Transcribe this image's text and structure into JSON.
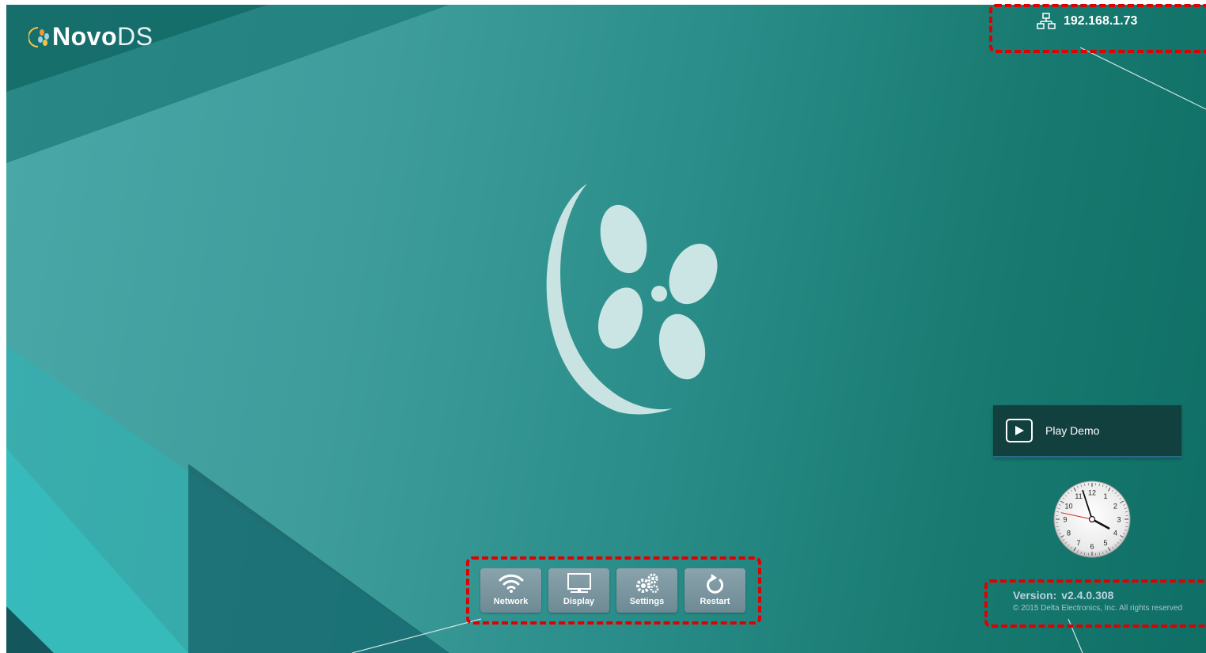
{
  "app": {
    "logo_bold": "Novo",
    "logo_light": "DS"
  },
  "network_status": {
    "icon": "ethernet-icon",
    "ip": "192.168.1.73"
  },
  "toolbar": {
    "buttons": [
      {
        "label": "Network",
        "icon": "wifi-icon"
      },
      {
        "label": "Display",
        "icon": "monitor-icon"
      },
      {
        "label": "Settings",
        "icon": "gears-icon"
      },
      {
        "label": "Restart",
        "icon": "restart-icon"
      }
    ]
  },
  "play_demo": {
    "label": "Play Demo",
    "icon": "play-icon"
  },
  "clock": {
    "numbers": [
      "12",
      "1",
      "2",
      "3",
      "4",
      "5",
      "6",
      "7",
      "8",
      "9",
      "10",
      "11"
    ],
    "hour": 3,
    "minute": 57,
    "second": 47
  },
  "version": {
    "label": "Version:",
    "number": "v2.4.0.308",
    "copyright": "© 2015 Delta Electronics, Inc. All rights reserved"
  },
  "colors": {
    "background_accent": "#17796f",
    "annotation": "#e00000",
    "button": "#7893a0",
    "play_demo_bg": "#12403f"
  }
}
